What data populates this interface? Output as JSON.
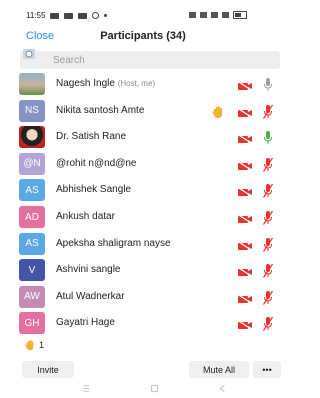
{
  "status_bar": {
    "time": "11:55"
  },
  "header": {
    "close_label": "Close",
    "title": "Participants (34)"
  },
  "search": {
    "placeholder": "Search"
  },
  "participants": [
    {
      "name": "Nagesh Ingle",
      "tag": "(Host, me)",
      "avatar": "photo",
      "video_off": true,
      "mic": "muted-gray",
      "hand": false
    },
    {
      "name": "Nikita santosh Amte",
      "tag": "",
      "avatar": "NS",
      "avatar_color": "#8693c5",
      "video_off": true,
      "mic": "muted-red",
      "hand": true
    },
    {
      "name": "Dr. Satish Rane",
      "tag": "",
      "avatar": "photo2",
      "video_off": true,
      "mic": "on-green",
      "hand": false
    },
    {
      "name": "@rohit n@nd@ne",
      "tag": "",
      "avatar": "@N",
      "avatar_color": "#b4a3d6",
      "video_off": true,
      "mic": "muted-red",
      "hand": false
    },
    {
      "name": "Abhishek Sangle",
      "tag": "",
      "avatar": "AS",
      "avatar_color": "#5aa8e6",
      "video_off": true,
      "mic": "muted-red",
      "hand": false
    },
    {
      "name": "Ankush datar",
      "tag": "",
      "avatar": "AD",
      "avatar_color": "#e46fa0",
      "video_off": true,
      "mic": "muted-red",
      "hand": false
    },
    {
      "name": "Apeksha shaligram nayse",
      "tag": "",
      "avatar": "AS",
      "avatar_color": "#5aa8e6",
      "video_off": true,
      "mic": "muted-red",
      "hand": false
    },
    {
      "name": "Ashvini sangle",
      "tag": "",
      "avatar": "V",
      "avatar_color": "#4355a8",
      "video_off": true,
      "mic": "muted-red",
      "hand": false
    },
    {
      "name": "Atul Wadnerkar",
      "tag": "",
      "avatar": "AW",
      "avatar_color": "#c78ab5",
      "video_off": true,
      "mic": "muted-red",
      "hand": false
    },
    {
      "name": "Gayatri Hage",
      "tag": "",
      "avatar": "GH",
      "avatar_color": "#e46fa0",
      "video_off": true,
      "mic": "muted-red",
      "hand": false
    }
  ],
  "reactions": {
    "raised_hands_count": "1"
  },
  "bottom_bar": {
    "invite_label": "Invite",
    "mute_all_label": "Mute All",
    "more_label": "•••"
  },
  "colors": {
    "accent": "#2d8cff",
    "muted_red": "#e8322f",
    "mic_green": "#4caf50",
    "hand_yellow": "#f2b531"
  }
}
